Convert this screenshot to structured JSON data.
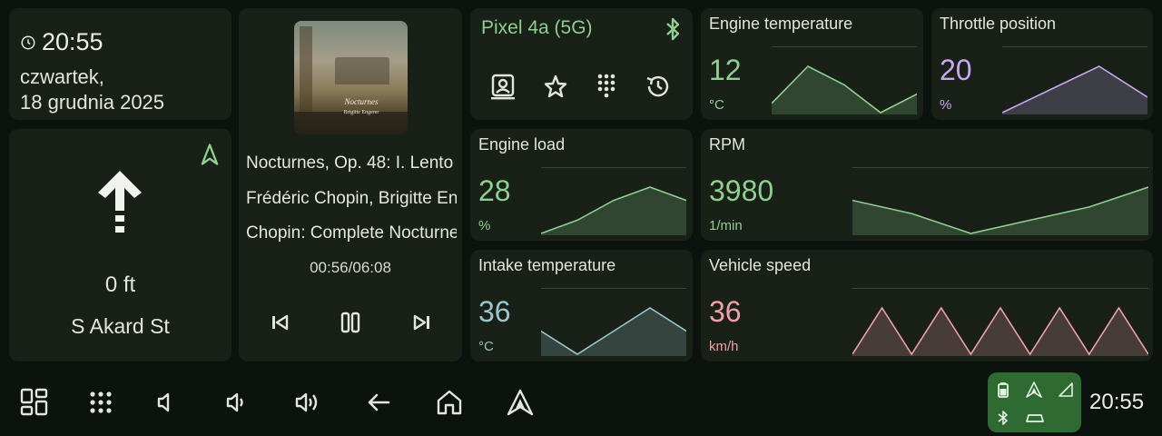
{
  "clock": {
    "time": "20:55",
    "date_line1": "czwartek,",
    "date_line2": "18 grudnia 2025"
  },
  "navigation": {
    "distance": "0 ft",
    "street": "S Akard St"
  },
  "media": {
    "track": "Nocturnes, Op. 48: I. Lento",
    "artist": "Frédéric Chopin, Brigitte Engerer",
    "album": "Chopin: Complete Nocturnes",
    "progress": "00:56/06:08",
    "album_art_title": "Nocturnes",
    "album_art_subtitle": "Brigitte Engerer"
  },
  "phone": {
    "name": "Pixel 4a (5G)"
  },
  "gauges": {
    "engine_temp": {
      "title": "Engine temperature",
      "value": "12",
      "unit": "°C",
      "color": "#8fcf8f"
    },
    "throttle": {
      "title": "Throttle position",
      "value": "20",
      "unit": "%",
      "color": "#c9a8f0"
    },
    "engine_load": {
      "title": "Engine load",
      "value": "28",
      "unit": "%",
      "color": "#8fcf8f"
    },
    "rpm": {
      "title": "RPM",
      "value": "3980",
      "unit": "1/min",
      "color": "#8fcf8f"
    },
    "intake": {
      "title": "Intake temperature",
      "value": "36",
      "unit": "°C",
      "color": "#9cc4cc"
    },
    "speed": {
      "title": "Vehicle speed",
      "value": "36",
      "unit": "km/h",
      "color": "#f0a0a8"
    }
  },
  "sparklines": {
    "engine_temp": [
      2,
      10,
      6,
      0,
      4
    ],
    "throttle": [
      1,
      4,
      7,
      3
    ],
    "engine_load": [
      1,
      3,
      6,
      8,
      6
    ],
    "rpm": [
      6,
      4,
      1,
      3,
      5,
      8
    ],
    "intake": [
      5,
      0,
      5,
      10,
      5
    ],
    "speed": [
      0,
      5,
      0,
      5,
      0,
      5,
      0,
      5,
      0,
      5,
      0
    ]
  },
  "statusbar": {
    "time": "20:55"
  },
  "colors": {
    "accent": "#8fcf8f",
    "status_pill": "#2f6a33",
    "card": "#182018",
    "background": "#0c120d"
  }
}
